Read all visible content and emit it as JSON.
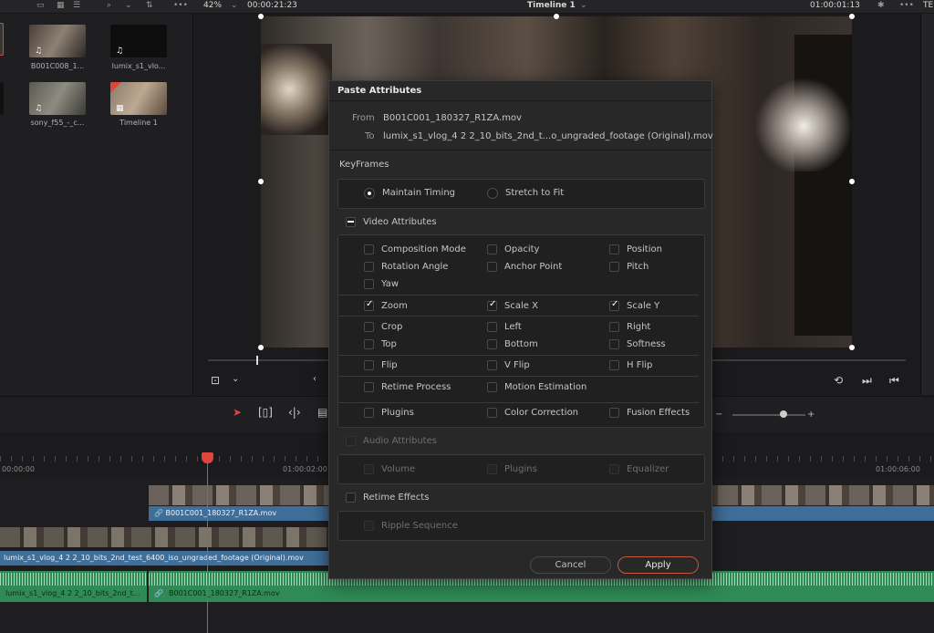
{
  "topbar": {
    "zoom": "42%",
    "timecode_left": "00:00:21:23",
    "timeline_name": "Timeline 1",
    "timecode_right": "01:00:01:13",
    "right_label": "TE"
  },
  "media_pool": {
    "items": [
      {
        "label": "B001C008_1..."
      },
      {
        "label": "lumix_s1_vlo..."
      },
      {
        "label": "sony_f55_-_c..."
      },
      {
        "label": "Timeline 1"
      }
    ]
  },
  "timeline": {
    "timecodes": [
      "00:00:00",
      "01:00:02:00",
      "01:00:06:00"
    ],
    "clips": {
      "v2": "B001C001_180327_R1ZA.mov",
      "v1": "lumix_s1_vlog_4 2 2_10_bits_2nd_test_6400_iso_ungraded_footage (Original).mov",
      "a1_left": "lumix_s1_vlog_4 2 2_10_bits_2nd_t...",
      "a1_right": "B001C001_180327_R1ZA.mov"
    }
  },
  "dialog": {
    "title": "Paste Attributes",
    "from_label": "From",
    "from_value": "B001C001_180327_R1ZA.mov",
    "to_label": "To",
    "to_value": "lumix_s1_vlog_4 2 2_10_bits_2nd_t...o_ungraded_footage (Original).mov",
    "keyframes": {
      "title": "KeyFrames",
      "options": [
        {
          "label": "Maintain Timing",
          "selected": true
        },
        {
          "label": "Stretch to Fit",
          "selected": false
        }
      ]
    },
    "video": {
      "title": "Video Attributes",
      "items": [
        {
          "label": "Composition Mode",
          "checked": false
        },
        {
          "label": "Opacity",
          "checked": false
        },
        {
          "label": "Position",
          "checked": false
        },
        {
          "label": "Rotation Angle",
          "checked": false
        },
        {
          "label": "Anchor Point",
          "checked": false
        },
        {
          "label": "Pitch",
          "checked": false
        },
        {
          "label": "Yaw",
          "checked": false
        },
        {
          "label": "Zoom",
          "checked": true
        },
        {
          "label": "Scale X",
          "checked": true
        },
        {
          "label": "Scale Y",
          "checked": true
        },
        {
          "label": "Crop",
          "checked": false
        },
        {
          "label": "Left",
          "checked": false
        },
        {
          "label": "Right",
          "checked": false
        },
        {
          "label": "Top",
          "checked": false
        },
        {
          "label": "Bottom",
          "checked": false
        },
        {
          "label": "Softness",
          "checked": false
        },
        {
          "label": "Flip",
          "checked": false
        },
        {
          "label": "V Flip",
          "checked": false
        },
        {
          "label": "H Flip",
          "checked": false
        },
        {
          "label": "Retime Process",
          "checked": false
        },
        {
          "label": "Motion Estimation",
          "checked": false
        },
        {
          "label": "Plugins",
          "checked": false
        },
        {
          "label": "Color Correction",
          "checked": false
        },
        {
          "label": "Fusion Effects",
          "checked": false
        }
      ]
    },
    "audio": {
      "title": "Audio Attributes",
      "items": [
        "Volume",
        "Plugins",
        "Equalizer"
      ]
    },
    "retime": {
      "title": "Retime Effects",
      "items": [
        "Ripple Sequence"
      ]
    },
    "buttons": {
      "cancel": "Cancel",
      "apply": "Apply"
    }
  },
  "colors": {
    "accent": "#e0443a",
    "video_clip": "#3f6e99",
    "audio_clip": "#2f8a55",
    "apply_border": "#c55a3a"
  }
}
